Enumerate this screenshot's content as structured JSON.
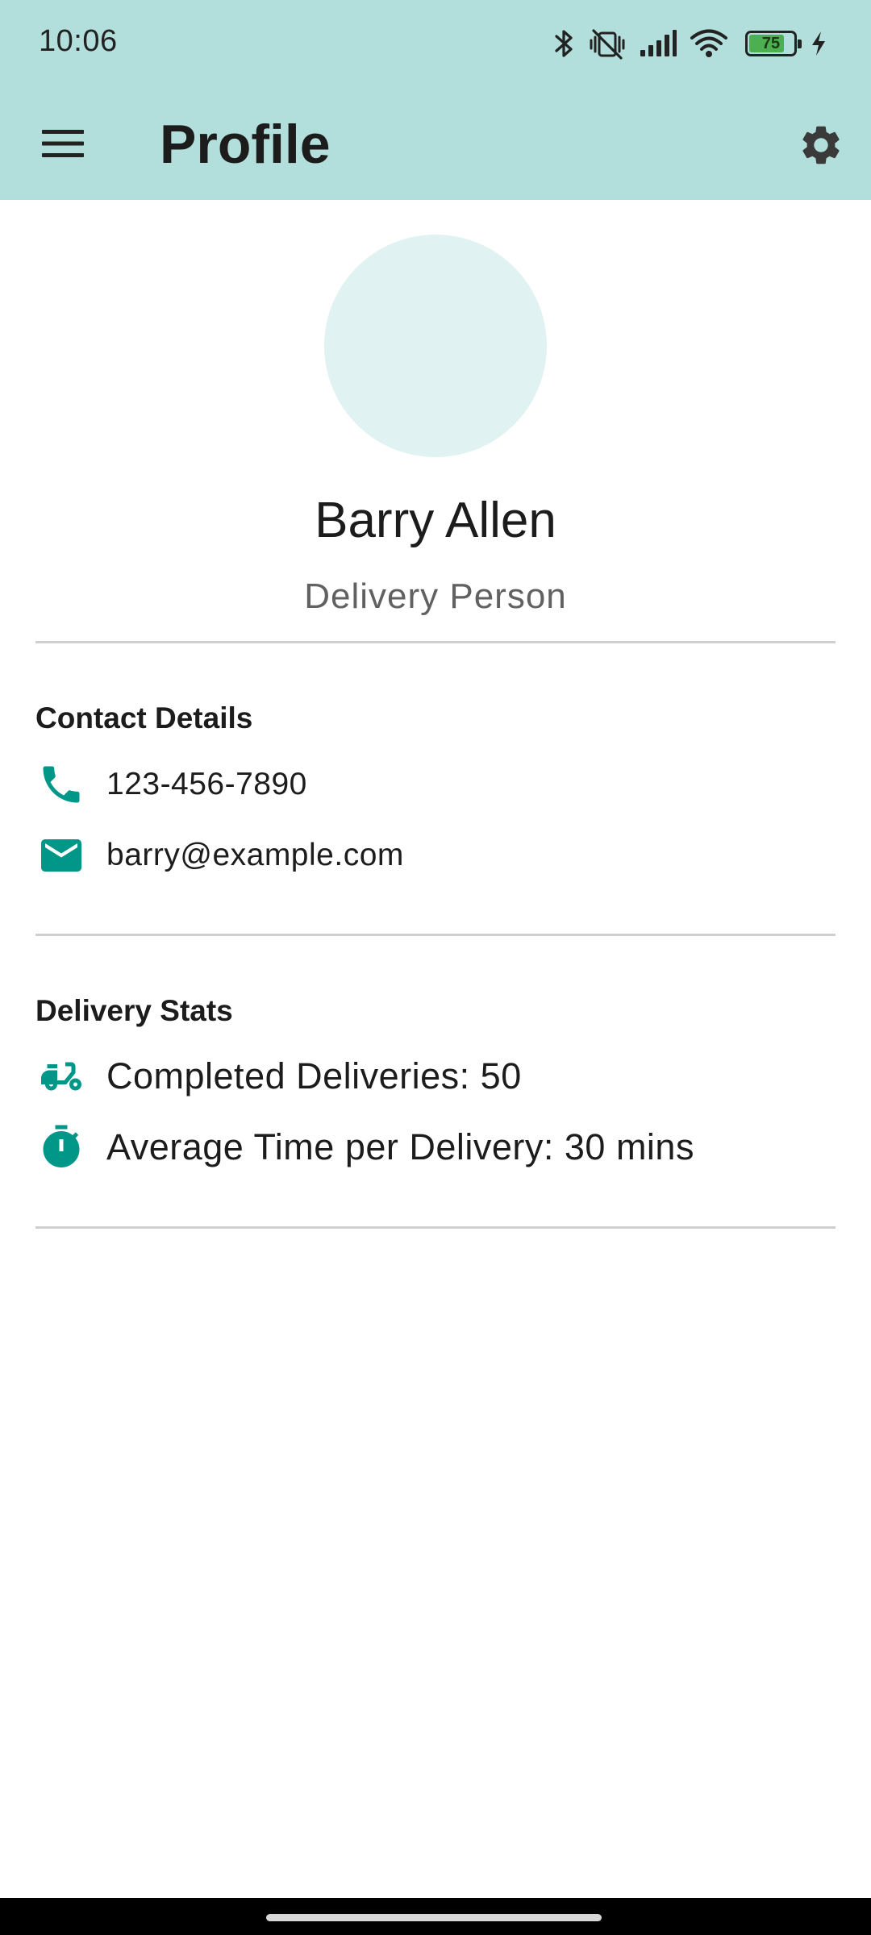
{
  "status_bar": {
    "time": "10:06",
    "battery_level": "75",
    "battery_percent": 75,
    "icons": [
      "bluetooth-icon",
      "vibrate-mute-icon",
      "signal-icon",
      "wifi-icon",
      "battery-icon",
      "charging-bolt-icon"
    ]
  },
  "app_bar": {
    "title": "Profile",
    "menu_icon": "hamburger-menu-icon",
    "settings_icon": "gear-icon",
    "background_color": "#b2dfdb"
  },
  "profile": {
    "name": "Barry Allen",
    "role": "Delivery Person",
    "avatar_color": "#e0f2f1"
  },
  "contact": {
    "title": "Contact Details",
    "phone": "123-456-7890",
    "email": "barry@example.com"
  },
  "stats": {
    "title": "Delivery Stats",
    "completed": "Completed Deliveries: 50",
    "average_time": "Average Time per Delivery: 30 mins"
  },
  "colors": {
    "accent": "#009688",
    "divider": "#cfcfcf"
  }
}
